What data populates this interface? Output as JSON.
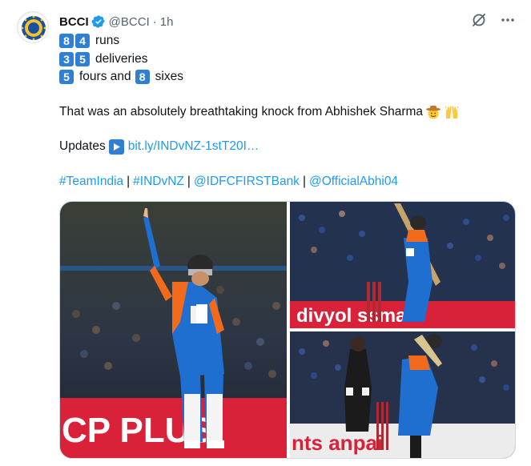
{
  "author": {
    "name": "BCCI",
    "handle": "@BCCI",
    "dot": "·",
    "time": "1h"
  },
  "header_icons": [
    "grok-icon",
    "more-icon"
  ],
  "body": {
    "line1": {
      "digits": [
        "8",
        "4"
      ],
      "text": "runs"
    },
    "line2": {
      "digits": [
        "3",
        "5"
      ],
      "text": "deliveries"
    },
    "line3": {
      "digit_a": "5",
      "text_a": "fours and",
      "digit_b": "8",
      "text_b": "sixes"
    },
    "sentence": "That was an absolutely breathtaking knock from Abhishek Sharma",
    "emojis": [
      "face-with-cowboy-hat-emoji",
      "raising-hands-emoji"
    ],
    "updates_label": "Updates",
    "updates_link": "bit.ly/INDvNZ-1stT20I…",
    "hashtags": [
      "#TeamIndia",
      "#INDvNZ",
      "@IDFCFIRSTBank",
      "@OfficialAbhi04"
    ],
    "separator": "|"
  },
  "media": {
    "photo1": {
      "banner_text": "CP PLUS"
    },
    "photo2": {
      "banner_text": "divyol  ssmar"
    },
    "photo3": {
      "banner_text": "nts  anpai"
    }
  },
  "colors": {
    "link": "#1d9bf0",
    "keycap": "#2f7fd4",
    "muted": "#536471",
    "india_blue": "#1e6fd0",
    "india_orange": "#f26b1d",
    "banner_red": "#d9213a"
  }
}
